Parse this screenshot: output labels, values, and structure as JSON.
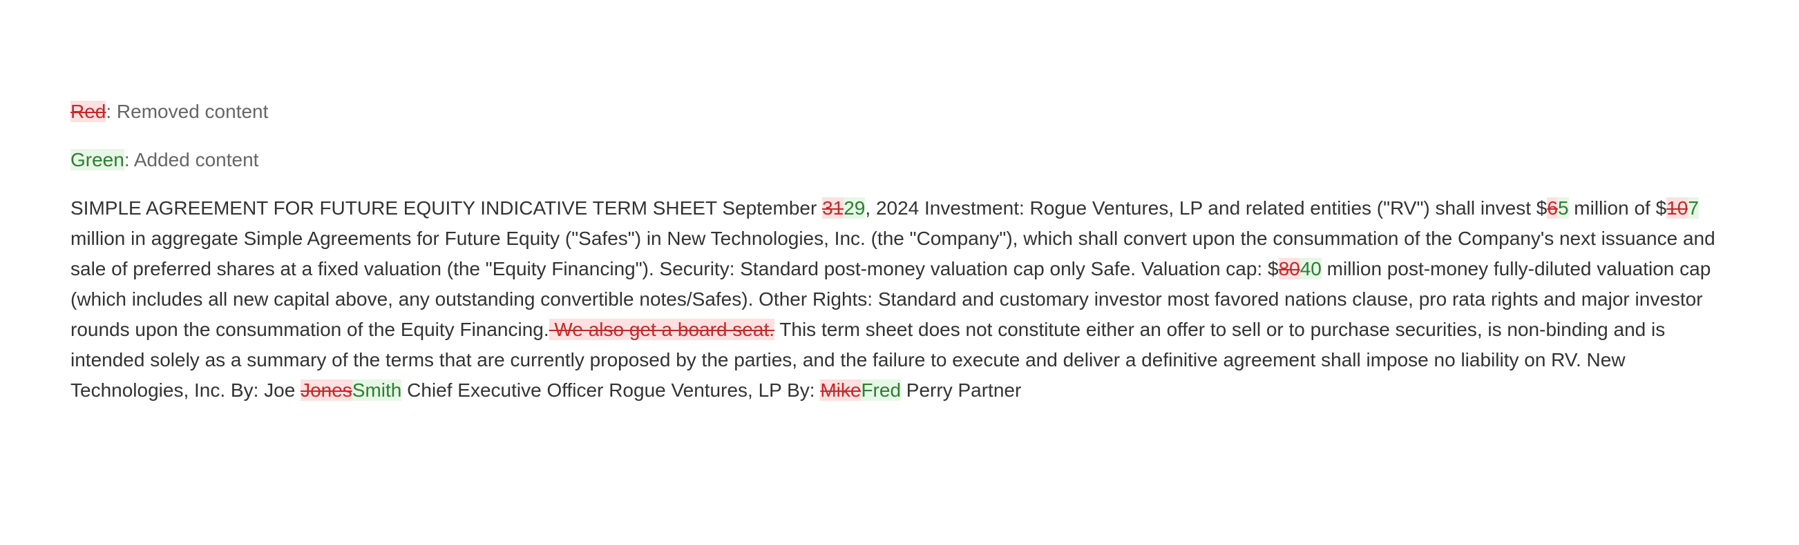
{
  "legend": {
    "removed_sample": "Red",
    "removed_label": ": Removed content",
    "added_sample": "Green",
    "added_label": ": Added content"
  },
  "colors": {
    "removed_bg": "#fde0e0",
    "removed_text": "#c62828",
    "added_bg": "#e6f7e6",
    "added_text": "#2e7d32",
    "body_text": "#333333"
  },
  "segments": [
    {
      "type": "text",
      "text": "SIMPLE AGREEMENT FOR FUTURE EQUITY INDICATIVE TERM SHEET September "
    },
    {
      "type": "del",
      "text": "31"
    },
    {
      "type": "ins",
      "text": "29"
    },
    {
      "type": "text",
      "text": ", 2024 Investment: Rogue Ventures, LP and related entities (\"RV\") shall invest $"
    },
    {
      "type": "del",
      "text": "6"
    },
    {
      "type": "ins",
      "text": "5"
    },
    {
      "type": "text",
      "text": " million of $"
    },
    {
      "type": "del",
      "text": "10"
    },
    {
      "type": "ins",
      "text": "7"
    },
    {
      "type": "text",
      "text": " million in aggregate Simple Agreements for Future Equity (\"Safes\") in New Technologies, Inc. (the \"Company\"), which shall convert upon the consummation of the Company's next issuance and sale of preferred shares at a fixed valuation (the \"Equity Financing\"). Security: Standard post-money valuation cap only Safe. Valuation cap: $"
    },
    {
      "type": "del",
      "text": "80"
    },
    {
      "type": "ins",
      "text": "40"
    },
    {
      "type": "text",
      "text": " million post-money fully-diluted valuation cap (which includes all new capital above, any outstanding convertible notes/Safes). Other Rights: Standard and customary investor most favored nations clause, pro rata rights and major investor rounds upon the consummation of the Equity Financing."
    },
    {
      "type": "del",
      "text": " We also get a board seat."
    },
    {
      "type": "text",
      "text": " This term sheet does not constitute either an offer to sell or to purchase securities, is non-binding and is intended solely as a summary of the terms that are currently proposed by the parties, and the failure to execute and deliver a definitive agreement shall impose no liability on RV. New Technologies, Inc. By: Joe "
    },
    {
      "type": "del",
      "text": "Jones"
    },
    {
      "type": "ins",
      "text": "Smith"
    },
    {
      "type": "text",
      "text": " Chief Executive Officer Rogue Ventures, LP By: "
    },
    {
      "type": "del",
      "text": "Mike"
    },
    {
      "type": "ins",
      "text": "Fred"
    },
    {
      "type": "text",
      "text": " Perry Partner"
    }
  ]
}
